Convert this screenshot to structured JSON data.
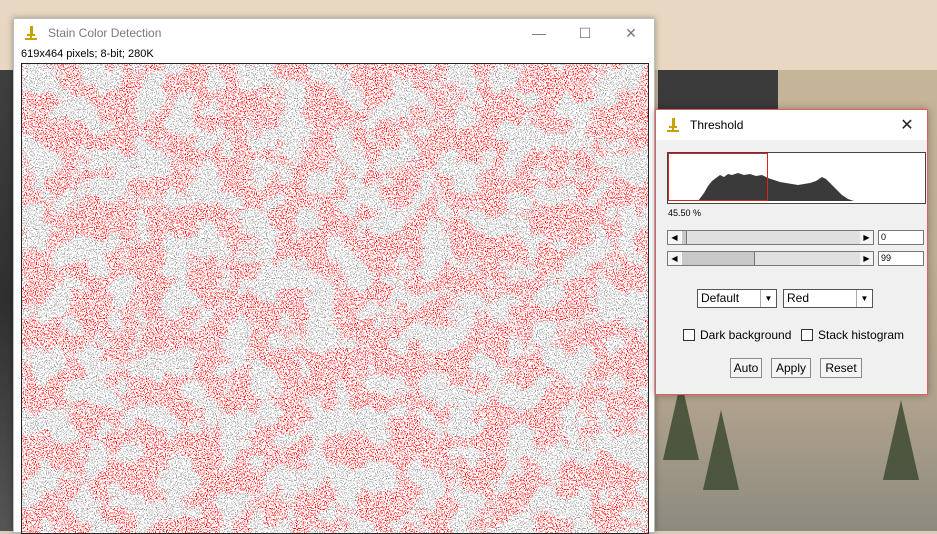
{
  "image_window": {
    "title": "Stain Color Detection",
    "info": "619x464 pixels; 8-bit; 280K",
    "controls": {
      "minimize": "—",
      "maximize": "☐",
      "close": "✕"
    }
  },
  "threshold": {
    "title": "Threshold",
    "close": "✕",
    "percent": "45.50 %",
    "min_value": "0",
    "max_value": "99",
    "method": "Default",
    "display": "Red",
    "dark_background_label": "Dark background",
    "stack_histogram_label": "Stack histogram",
    "dark_background_checked": false,
    "stack_histogram_checked": false,
    "buttons": {
      "auto": "Auto",
      "apply": "Apply",
      "reset": "Reset"
    }
  },
  "colors": {
    "overlay": "#ff0000",
    "tissue": "#9a9a9a",
    "accent_border": "#e06060"
  }
}
